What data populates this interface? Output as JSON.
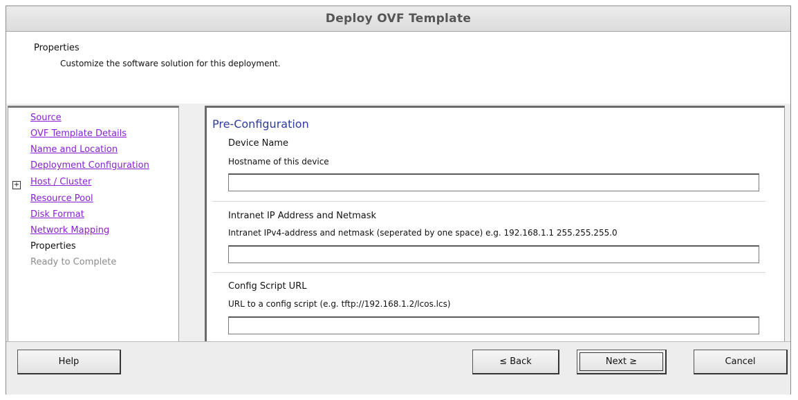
{
  "window": {
    "title": "Deploy OVF Template"
  },
  "header": {
    "title": "Properties",
    "subtitle": "Customize the software solution for this deployment."
  },
  "steps": [
    {
      "label": "Source",
      "state": "link"
    },
    {
      "label": "OVF Template Details",
      "state": "link"
    },
    {
      "label": "Name and Location",
      "state": "link"
    },
    {
      "label": "Deployment Configuration",
      "state": "link"
    },
    {
      "label": "Host / Cluster",
      "state": "link",
      "expander": "+"
    },
    {
      "label": "Resource Pool",
      "state": "link"
    },
    {
      "label": "Disk Format",
      "state": "link"
    },
    {
      "label": "Network Mapping",
      "state": "link"
    },
    {
      "label": "Properties",
      "state": "current"
    },
    {
      "label": "Ready to Complete",
      "state": "disabled"
    }
  ],
  "content": {
    "section_title": "Pre-Configuration",
    "fields": [
      {
        "label": "Device Name",
        "description": "Hostname of this device",
        "value": ""
      },
      {
        "label": "Intranet IP Address and Netmask",
        "description": "Intranet IPv4-address and netmask (seperated by one space) e.g. 192.168.1.1 255.255.255.0",
        "value": ""
      },
      {
        "label": "Config Script URL",
        "description": "URL to a config script (e.g. tftp://192.168.1.2/lcos.lcs)",
        "value": ""
      }
    ]
  },
  "footer": {
    "help_label": "Help",
    "back_label": "≤ Back",
    "next_label": "Next ≥",
    "cancel_label": "Cancel"
  },
  "colors": {
    "link": "#8a1fd6",
    "section_title": "#2f3aa0",
    "disabled": "#8c8c8c"
  }
}
